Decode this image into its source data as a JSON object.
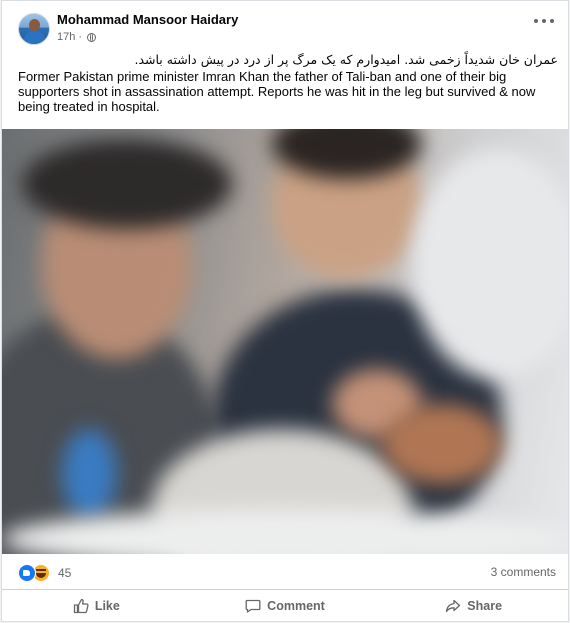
{
  "post": {
    "author": "Mohammad Mansoor Haidary",
    "time": "17h",
    "text_fa": "عمران خان شدیداً زخمی شد. امیدوارم که یک مرگ پر از درد در پیش داشته باشد.",
    "text_en": "Former Pakistan prime minister Imran Khan the father of Tali-ban and one of their big supporters shot in assassination attempt. Reports he was hit in the leg but survived & now being treated in hospital."
  },
  "stats": {
    "reaction_count": "45",
    "comments": "3 comments"
  },
  "actions": {
    "like": "Like",
    "comment": "Comment",
    "share": "Share"
  },
  "icons": {
    "privacy": "globe-icon",
    "more": "more-options-icon",
    "reactions": [
      "like-reaction-icon",
      "haha-reaction-icon"
    ]
  },
  "colors": {
    "accent": "#1877f2",
    "secondary_text": "#65676b"
  }
}
